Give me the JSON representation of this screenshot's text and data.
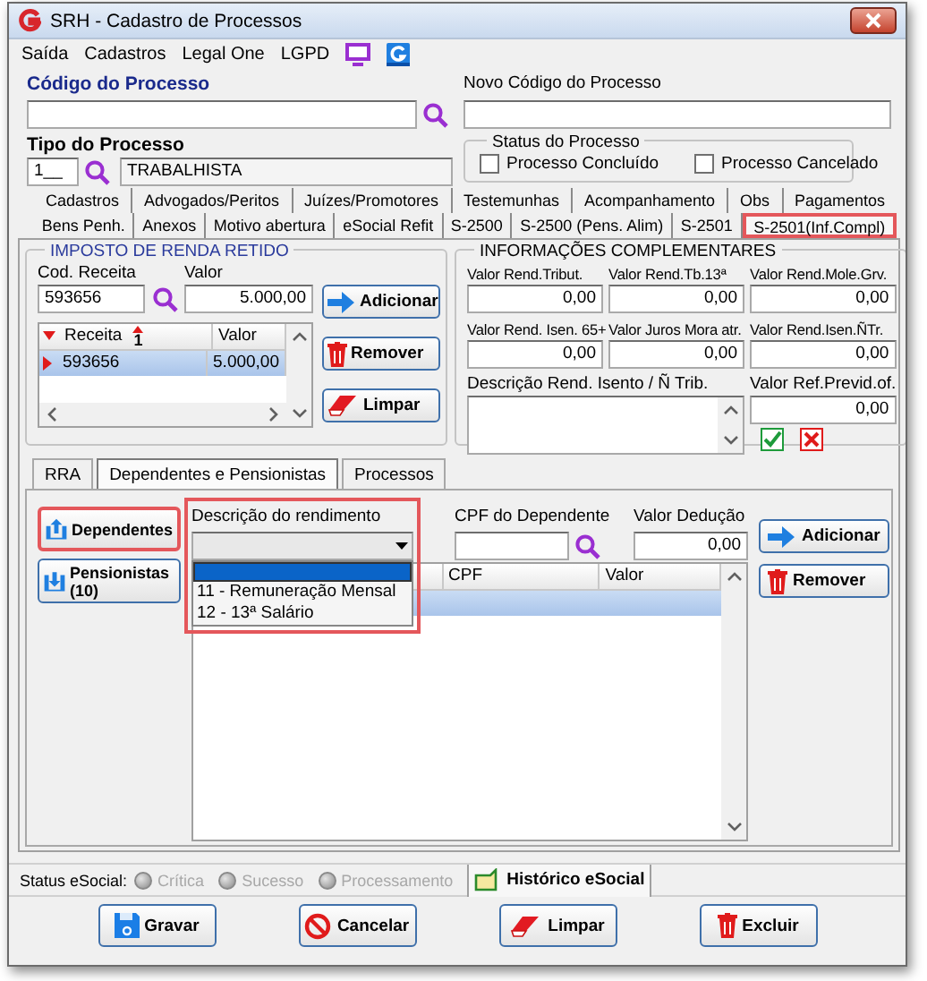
{
  "window": {
    "title": "SRH - Cadastro de Processos"
  },
  "menu": [
    "Saída",
    "Cadastros",
    "Legal One",
    "LGPD"
  ],
  "process": {
    "code_label": "Código do Processo",
    "new_code_label": "Novo Código do Processo",
    "type_label": "Tipo do Processo",
    "type_code": "1__",
    "type_name": "TRABALHISTA"
  },
  "status_group": {
    "title": "Status do Processo",
    "options": [
      {
        "label": "Processo Concluído",
        "checked": false
      },
      {
        "label": "Processo Cancelado",
        "checked": false
      }
    ]
  },
  "tabs": [
    [
      {
        "label": "Cadastros",
        "selected": false,
        "highlighted": false
      },
      {
        "label": "Advogados/Peritos",
        "selected": false,
        "highlighted": false
      },
      {
        "label": "Juízes/Promotores",
        "selected": false,
        "highlighted": false
      },
      {
        "label": "Testemunhas",
        "selected": false,
        "highlighted": false
      },
      {
        "label": "Acompanhamento",
        "selected": false,
        "highlighted": false
      },
      {
        "label": "Obs",
        "selected": false,
        "highlighted": false
      },
      {
        "label": "Pagamentos",
        "selected": false,
        "highlighted": false
      }
    ],
    [
      {
        "label": "Bens Penh.",
        "selected": false,
        "highlighted": false
      },
      {
        "label": "Anexos",
        "selected": false,
        "highlighted": false
      },
      {
        "label": "Motivo abertura",
        "selected": false,
        "highlighted": false
      },
      {
        "label": "eSocial Refit",
        "selected": false,
        "highlighted": false
      },
      {
        "label": "S-2500",
        "selected": false,
        "highlighted": false
      },
      {
        "label": "S-2500 (Pens. Alim)",
        "selected": false,
        "highlighted": false
      },
      {
        "label": "S-2501",
        "selected": false,
        "highlighted": false
      },
      {
        "label": "S-2501(Inf.Compl)",
        "selected": true,
        "highlighted": true
      }
    ]
  ],
  "income_tax": {
    "title": "IMPOSTO DE RENDA RETIDO",
    "code_label": "Cod. Receita",
    "code_value": "593656",
    "value_label": "Valor",
    "value": "5.000,00",
    "buttons": [
      {
        "label": "Adicionar",
        "kind": "add"
      },
      {
        "label": "Remover",
        "kind": "remove"
      },
      {
        "label": "Limpar",
        "kind": "clear"
      }
    ],
    "grid": {
      "columns": [
        {
          "label": "Receita",
          "sort": "1"
        },
        {
          "label": "Valor"
        }
      ],
      "rows": [
        {
          "cells": [
            "593656",
            "5.000,00"
          ],
          "selected": true
        }
      ]
    }
  },
  "complementary": {
    "title": "INFORMAÇÕES COMPLEMENTARES",
    "fields": [
      {
        "label": "Valor Rend.Tribut.",
        "value": "0,00"
      },
      {
        "label": "Valor Rend.Tb.13ª",
        "value": "0,00"
      },
      {
        "label": "Valor Rend.Mole.Grv.",
        "value": "0,00"
      },
      {
        "label": "Valor Rend. Isen. 65+",
        "value": "0,00"
      },
      {
        "label": "Valor Juros Mora atr.",
        "value": "0,00"
      },
      {
        "label": "Valor Rend.Isen.ÑTr.",
        "value": "0,00"
      }
    ],
    "description_label": "Descrição Rend. Isento / Ñ Trib.",
    "pension_label": "Valor Ref.Previd.of.",
    "pension_value": "0,00"
  },
  "subtabs": [
    {
      "label": "RRA",
      "selected": false
    },
    {
      "label": "Dependentes e Pensionistas",
      "selected": true
    },
    {
      "label": "Processos",
      "selected": false
    }
  ],
  "dependents": {
    "side_buttons": [
      {
        "label": "Dependentes",
        "highlighted": true
      },
      {
        "label": "Pensionistas (10)",
        "highlighted": false
      }
    ],
    "income_label": "Descrição do rendimento",
    "income_dropdown": {
      "expanded": true,
      "highlighted": true,
      "blank_selected": true,
      "options": [
        {
          "label": "11 - Remuneração Mensal",
          "selected": false
        },
        {
          "label": "12 - 13ª Salário",
          "selected": false
        }
      ]
    },
    "cpf_label": "CPF do Dependente",
    "deduction_label": "Valor Dedução",
    "deduction_value": "0,00",
    "buttons": [
      {
        "label": "Adicionar",
        "kind": "add"
      },
      {
        "label": "Remover",
        "kind": "remove"
      }
    ],
    "grid": {
      "columns": [
        "CPF",
        "Valor"
      ],
      "rows": [
        {
          "selected": true
        }
      ]
    }
  },
  "status_bar": {
    "label": "Status eSocial:",
    "indicators": [
      {
        "label": "Crítica",
        "disabled": true
      },
      {
        "label": "Sucesso",
        "disabled": true
      },
      {
        "label": "Processamento",
        "disabled": true
      }
    ],
    "history_button": "Histórico eSocial"
  },
  "actions": [
    {
      "label": "Gravar",
      "kind": "save"
    },
    {
      "label": "Cancelar",
      "kind": "cancel"
    },
    {
      "label": "Limpar",
      "kind": "clear"
    },
    {
      "label": "Excluir",
      "kind": "delete"
    }
  ]
}
